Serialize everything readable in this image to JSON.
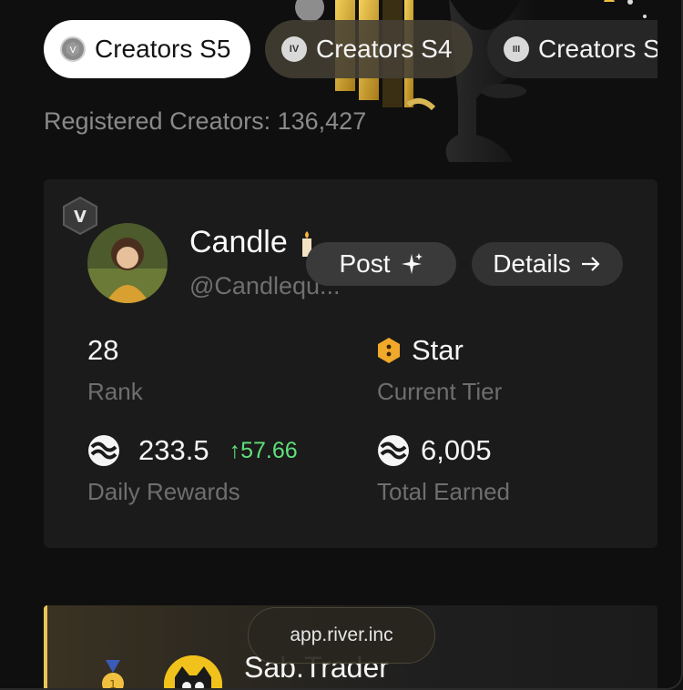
{
  "tabs": [
    {
      "label": "Creators S5",
      "badge": "V",
      "active": true
    },
    {
      "label": "Creators S4",
      "badge": "IV",
      "active": false
    },
    {
      "label": "Creators S",
      "badge": "III",
      "active": false
    }
  ],
  "registered_text": "Registered Creators: 136,427",
  "creator_card": {
    "tier_badge": "V",
    "name": "Candle",
    "handle": "@Candlequ...",
    "post_label": "Post",
    "details_label": "Details",
    "stats": {
      "rank_value": "28",
      "rank_label": "Rank",
      "tier_value": "Star",
      "tier_label": "Current Tier",
      "daily_value": "233.5",
      "daily_delta": "57.66",
      "daily_label": "Daily Rewards",
      "total_value": "6,005",
      "total_label": "Total Earned"
    }
  },
  "second_card": {
    "name": "Sab.Trader"
  },
  "url_pill": "app.river.inc",
  "colors": {
    "background": "#0f0f0f",
    "card": "#1b1b1b",
    "positive": "#5fe07a",
    "accent_gold": "#e8c55a"
  },
  "icons": {
    "post": "sparkle-icon",
    "details": "arrow-right-icon",
    "delta": "arrow-up-icon",
    "rewards": "river-coin-icon",
    "tier": "star-tier-icon"
  }
}
